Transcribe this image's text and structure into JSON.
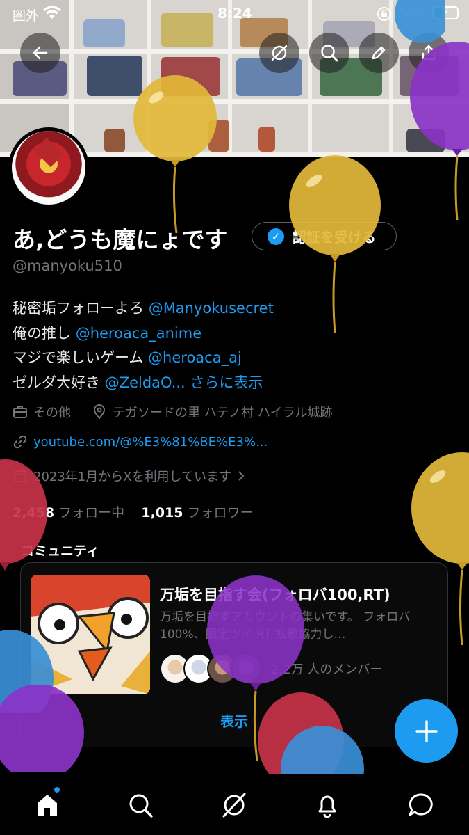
{
  "status_bar": {
    "carrier": "圏外",
    "time": "8:24",
    "battery": "34%"
  },
  "profile": {
    "name": "あ,どうも魔にょです",
    "verify_label": "認証を受ける",
    "handle": "@manyoku510",
    "bio": [
      {
        "text": "秘密垢フォローよろ ",
        "link": "@Manyokusecret"
      },
      {
        "text": "俺の推し ",
        "link": "@heroaca_anime"
      },
      {
        "text": "マジで楽しいゲーム ",
        "link": "@heroaca_aj"
      },
      {
        "text": "ゼルダ大好き ",
        "link": "@ZeldaO...",
        "more": "さらに表示"
      }
    ],
    "category": "その他",
    "location": "テガソードの里 ハテノ村 ハイラル城跡",
    "website": "youtube.com/@%E3%81%BE%E3%...",
    "joined": "2023年1月からXを利用しています",
    "following_count": "2,458",
    "following_label": "フォロー中",
    "followers_count": "1,015",
    "followers_label": "フォロワー"
  },
  "community": {
    "section_title": "コミュニティ",
    "title": "万垢を目指す会(フォロバ100,RT)",
    "description": "万垢を目指すアカウントの集いです。 フォロバ100%、固定ツイ RT 拡散協力し…",
    "members": "2.2万 人のメンバー",
    "show_label": "表示"
  },
  "icons": {
    "back": "back-arrow-icon",
    "grok": "grok-icon",
    "search": "search-icon",
    "edit": "pencil-icon",
    "share": "share-icon",
    "home": "home-icon",
    "explore": "search-icon",
    "notifications": "bell-icon",
    "messages": "chat-icon",
    "compose": "plus-icon"
  },
  "colors": {
    "accent": "#1d9bf0",
    "background": "#000000",
    "muted": "#71767b",
    "balloon_yellow": "#e2b83a",
    "balloon_purple": "#8b33c7",
    "balloon_red": "#c8334a",
    "balloon_blue": "#3a8fd6"
  }
}
